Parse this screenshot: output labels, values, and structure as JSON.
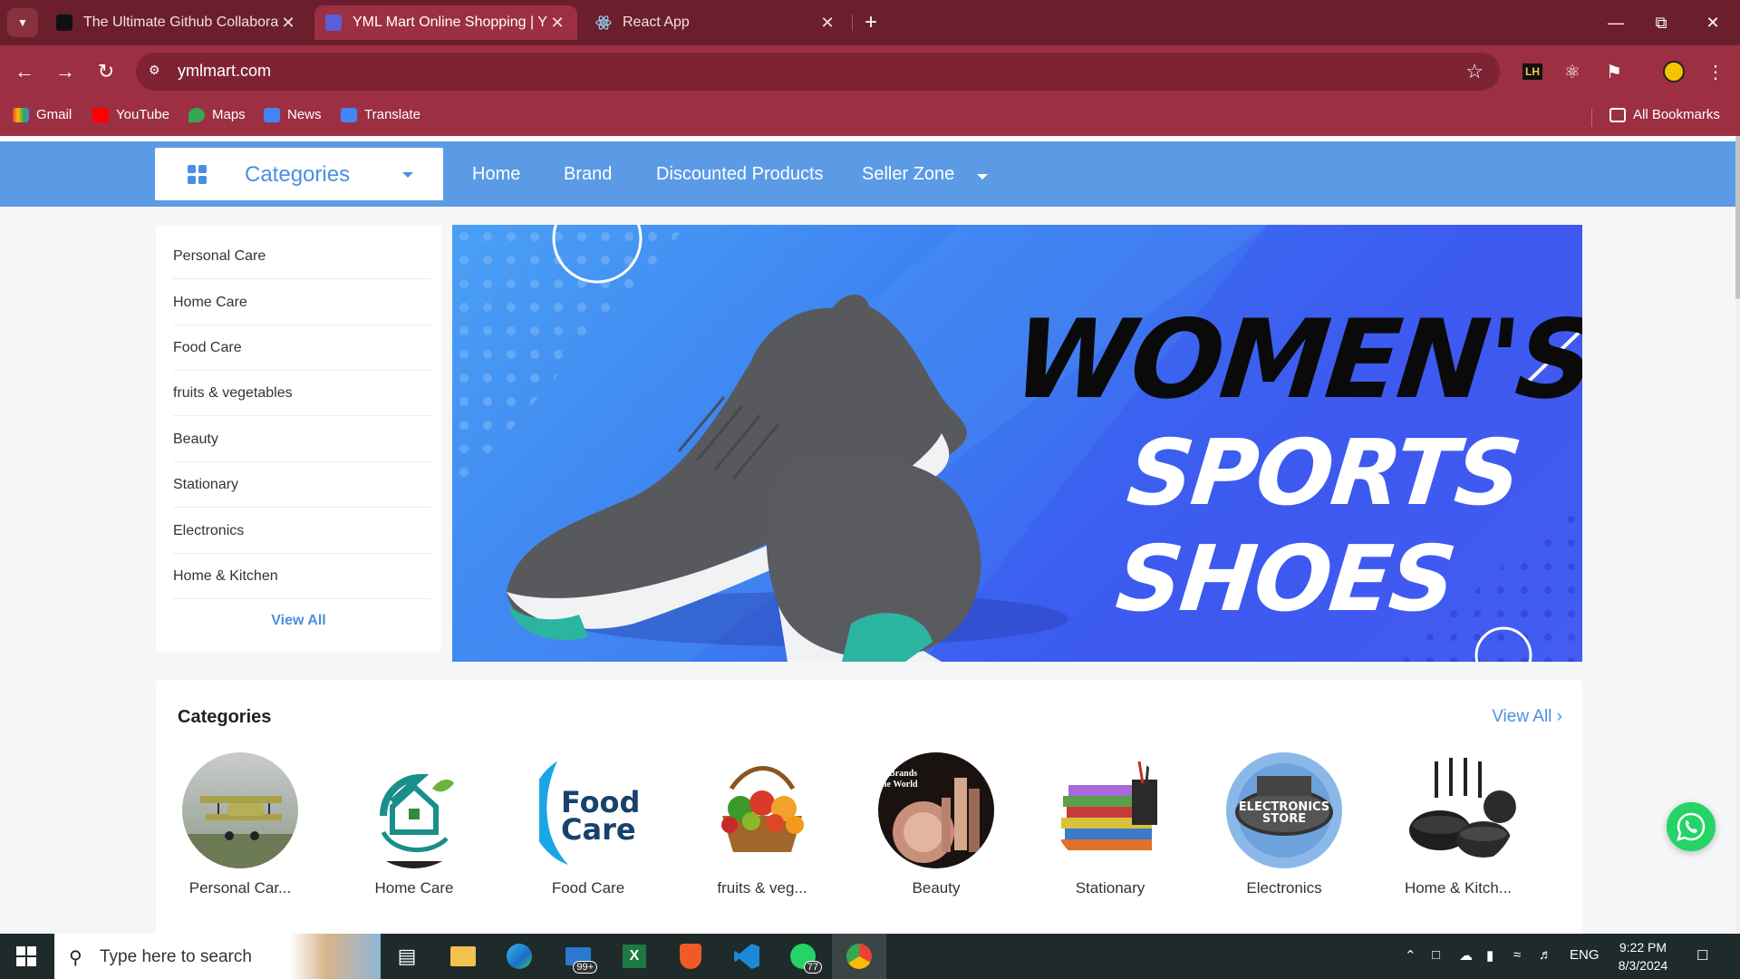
{
  "browser": {
    "tabs": [
      {
        "title": "The Ultimate Github Collaborati",
        "active": false
      },
      {
        "title": "YML Mart Online Shopping | YM",
        "active": true
      },
      {
        "title": "React App",
        "active": false
      }
    ],
    "url": "ymlmart.com",
    "bookmarks": [
      {
        "label": "Gmail"
      },
      {
        "label": "YouTube"
      },
      {
        "label": "Maps"
      },
      {
        "label": "News"
      },
      {
        "label": "Translate"
      }
    ],
    "all_bookmarks": "All Bookmarks"
  },
  "site": {
    "categories_button": "Categories",
    "nav": [
      "Home",
      "Brand",
      "Discounted Products",
      "Seller Zone"
    ],
    "sidebar": {
      "items": [
        "Personal Care",
        "Home Care",
        "Food Care",
        "fruits & vegetables",
        "Beauty",
        "Stationary",
        "Electronics",
        "Home & Kitchen"
      ],
      "view_all": "View All"
    },
    "banner": {
      "line1": "WOMEN'S",
      "line2": "SPORTS SHOES"
    },
    "categories": {
      "title": "Categories",
      "view_all": "View All",
      "items": [
        {
          "label": "Personal Car...",
          "icon": "airplane-icon"
        },
        {
          "label": "Home Care",
          "icon": "home-care-icon"
        },
        {
          "label": "Food Care",
          "icon": "food-care-logo",
          "logo_text_1": "Food",
          "logo_text_2": "Care"
        },
        {
          "label": "fruits & veg...",
          "icon": "fruit-basket-icon"
        },
        {
          "label": "Beauty",
          "icon": "beauty-products-icon",
          "logo_text_1": "p Brands",
          "logo_text_2": "he World"
        },
        {
          "label": "Stationary",
          "icon": "books-icon"
        },
        {
          "label": "Electronics",
          "icon": "electronics-store-icon",
          "logo_text_1": "ELECTRONICS",
          "logo_text_2": "STORE"
        },
        {
          "label": "Home & Kitch...",
          "icon": "cookware-icon"
        }
      ]
    }
  },
  "taskbar": {
    "search_placeholder": "Type here to search",
    "mail_badge": "99+",
    "whatsapp_badge": "77",
    "language": "ENG",
    "time": "9:22 PM",
    "date": "8/3/2024"
  },
  "colors": {
    "accent": "#4a90e2",
    "nav_strip": "#5b9be6",
    "chrome": "#9d2f43",
    "whatsapp": "#25d366"
  }
}
